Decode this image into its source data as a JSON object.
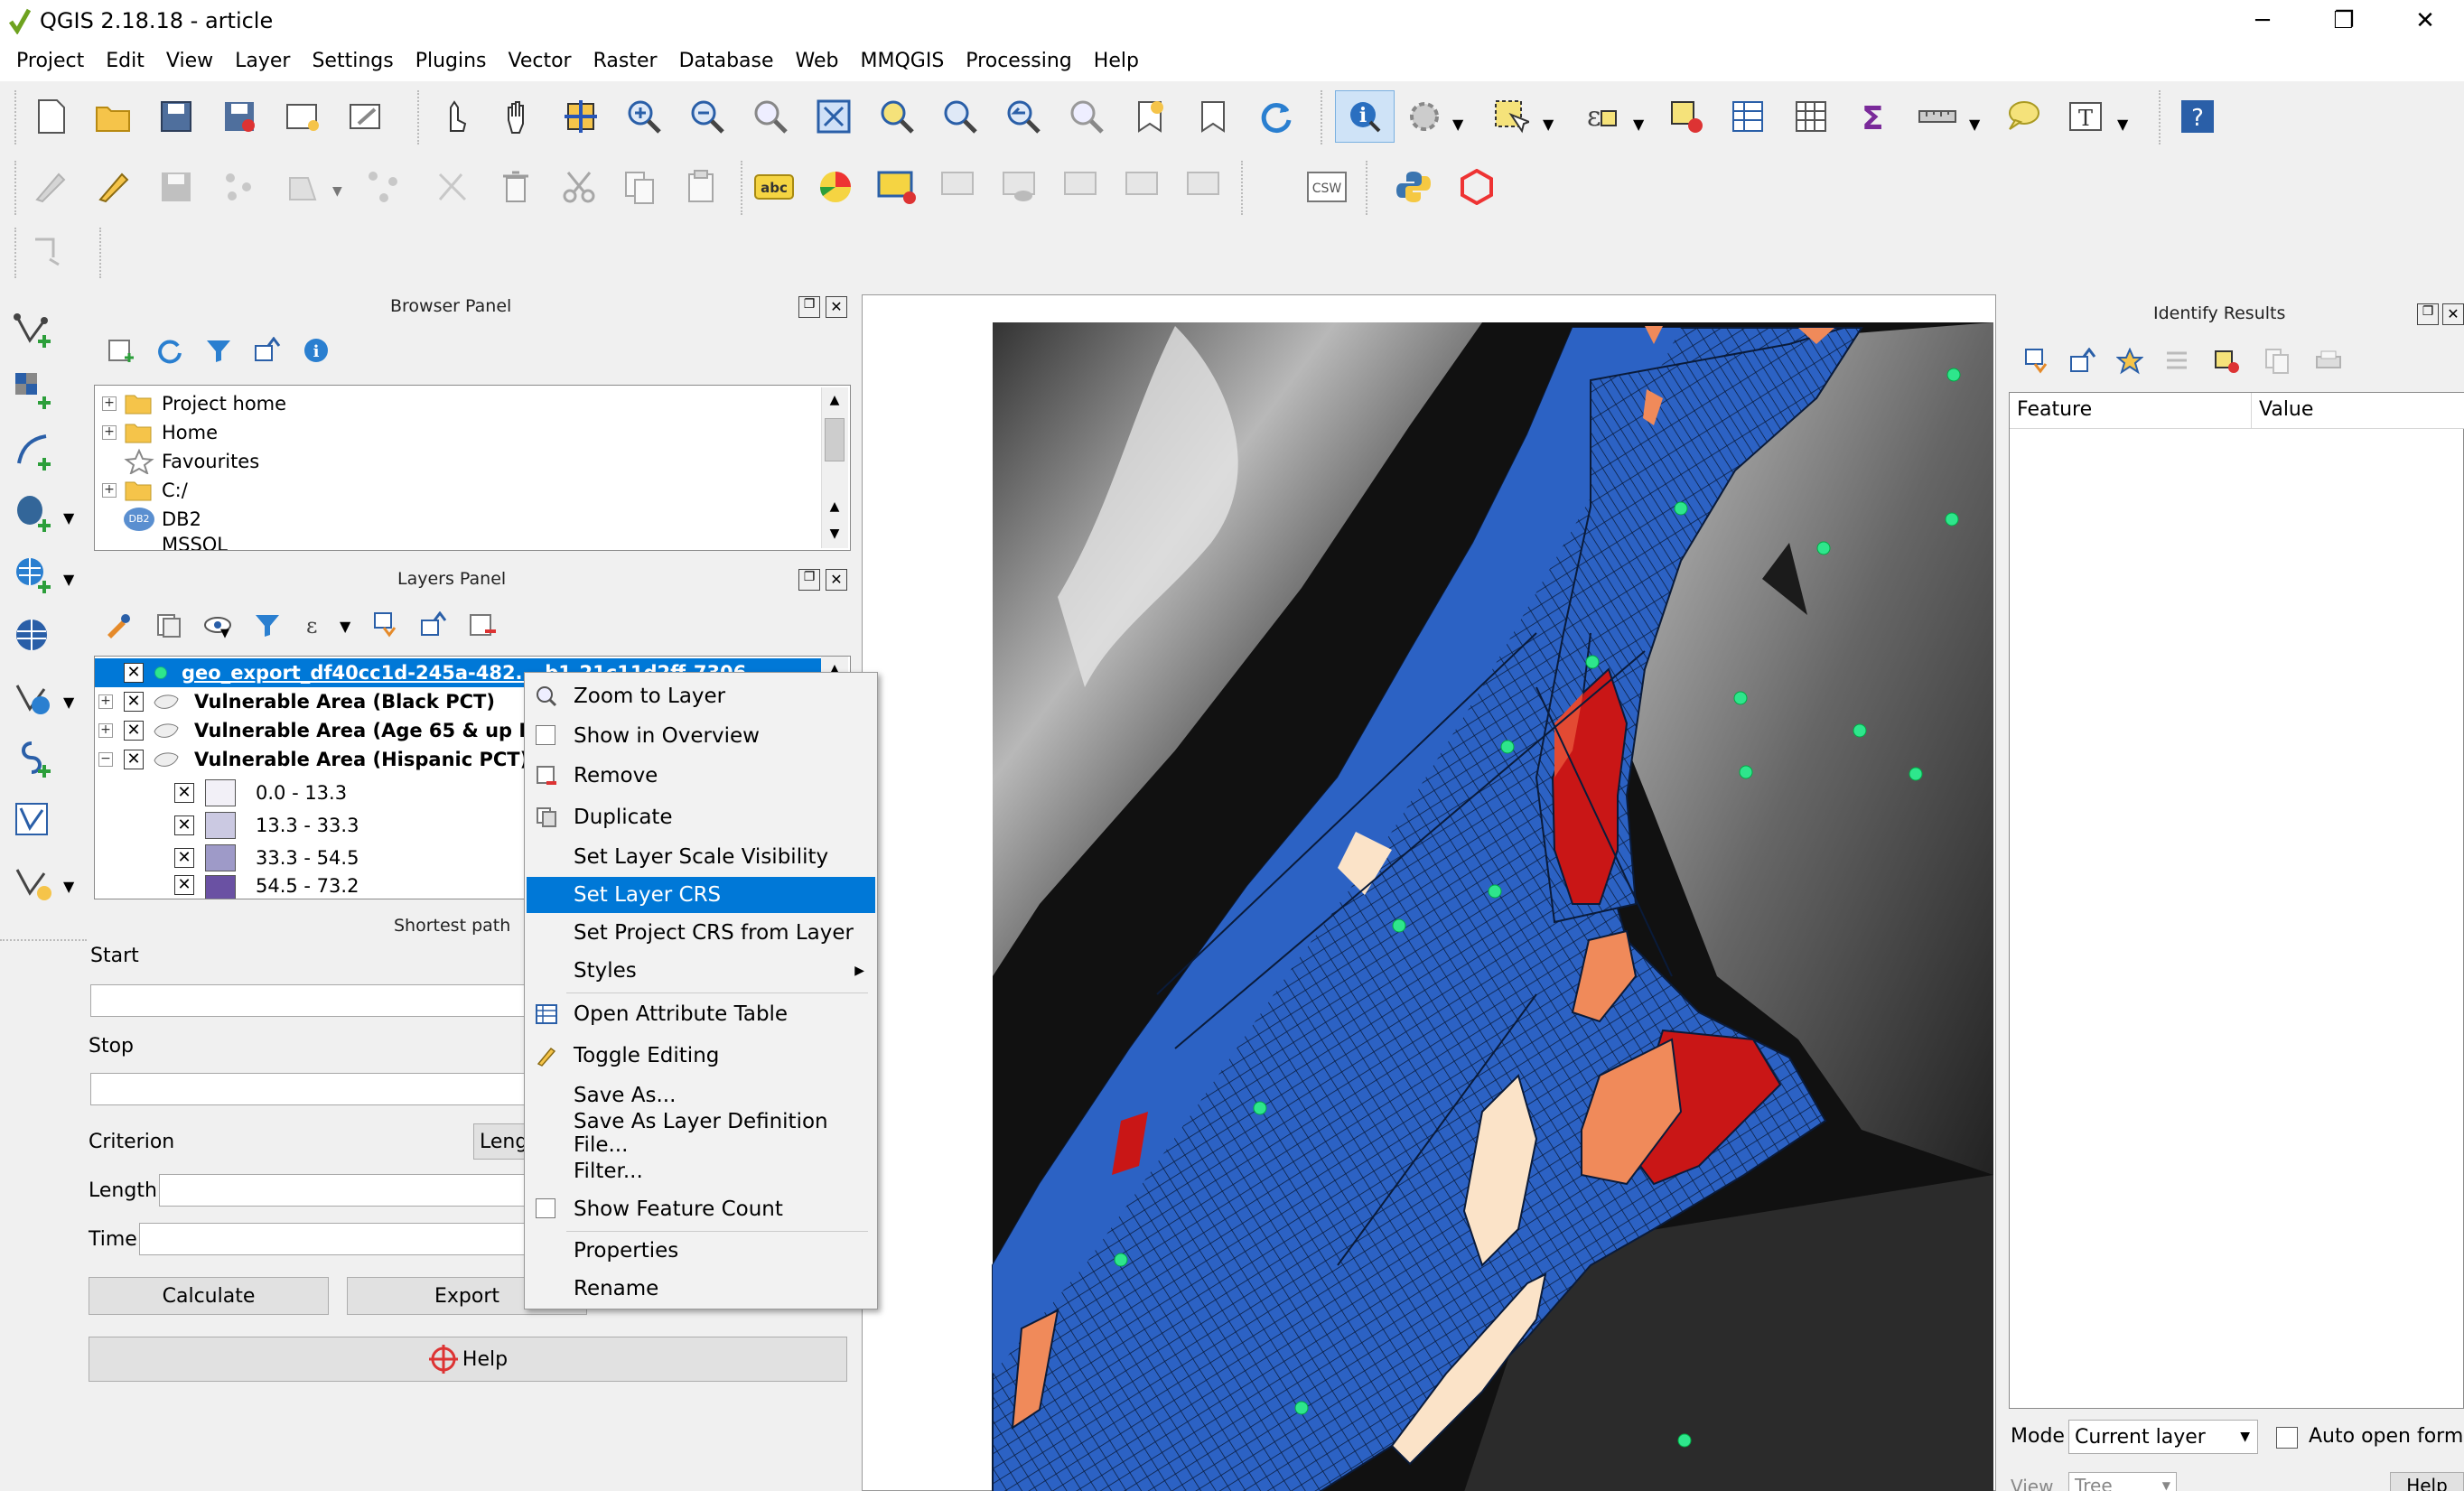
{
  "window": {
    "title": "QGIS 2.18.18 - article",
    "controls": [
      "─",
      "❐",
      "✕"
    ]
  },
  "menu": [
    "Project",
    "Edit",
    "View",
    "Layer",
    "Settings",
    "Plugins",
    "Vector",
    "Raster",
    "Database",
    "Web",
    "MMQGIS",
    "Processing",
    "Help"
  ],
  "browser": {
    "title": "Browser Panel",
    "items": [
      "Project home",
      "Home",
      "Favourites",
      "C:/",
      "DB2",
      "MSSQL"
    ],
    "db2_badge": "DB2"
  },
  "layers": {
    "title": "Layers Panel",
    "items": [
      "geo_export_df40cc1d-245a-482...-b1-21c11d2ff-7306",
      "Vulnerable Area (Black PCT)",
      "Vulnerable Area (Age 65 & up P",
      "Vulnerable Area (Hispanic PCT)"
    ],
    "legend": [
      {
        "label": "0.0 - 13.3",
        "color": "#f2f0f7"
      },
      {
        "label": "13.3 - 33.3",
        "color": "#cbc9e2"
      },
      {
        "label": "33.3 - 54.5",
        "color": "#9e9ac8"
      },
      {
        "label": "54.5 - 73.2",
        "color": "#6a51a3"
      }
    ]
  },
  "shortest_path": {
    "title": "Shortest path",
    "start_label": "Start",
    "stop_label": "Stop",
    "criterion_label": "Criterion",
    "criterion_value": "Leng",
    "length_label": "Length",
    "time_label": "Time",
    "calculate": "Calculate",
    "export": "Export",
    "help": "Help"
  },
  "context_menu": [
    {
      "label": "Zoom to Layer",
      "icon": "zoom-icon"
    },
    {
      "label": "Show in Overview",
      "icon": "checkbox-icon"
    },
    {
      "label": "Remove",
      "icon": "remove-icon"
    },
    {
      "label": "Duplicate",
      "icon": "duplicate-icon"
    },
    {
      "label": "Set Layer Scale Visibility",
      "icon": ""
    },
    {
      "label": "Set Layer CRS",
      "icon": "",
      "highlighted": true
    },
    {
      "label": "Set Project CRS from Layer",
      "icon": ""
    },
    {
      "label": "Styles",
      "icon": "",
      "submenu": true
    },
    {
      "label": "Open Attribute Table",
      "icon": "table-icon"
    },
    {
      "label": "Toggle Editing",
      "icon": "pencil-icon"
    },
    {
      "label": "Save As...",
      "icon": ""
    },
    {
      "label": "Save As Layer Definition File...",
      "icon": ""
    },
    {
      "label": "Filter...",
      "icon": ""
    },
    {
      "label": "Show Feature Count",
      "icon": "checkbox-icon"
    },
    {
      "label": "Properties",
      "icon": ""
    },
    {
      "label": "Rename",
      "icon": ""
    }
  ],
  "identify": {
    "title": "Identify Results",
    "col_feature": "Feature",
    "col_value": "Value",
    "mode_label": "Mode",
    "mode_value": "Current layer",
    "auto_open": "Auto open form",
    "view_label": "View",
    "view_value": "Tree",
    "help": "Help"
  },
  "toolbar_labels": {
    "csw": "CSW",
    "abc": "abc"
  },
  "colors": {
    "map_water": "#2c62c4",
    "highlight": "#0078d7",
    "red": "#c91616",
    "orange": "#f08a5a",
    "points": "#2ee68c"
  }
}
